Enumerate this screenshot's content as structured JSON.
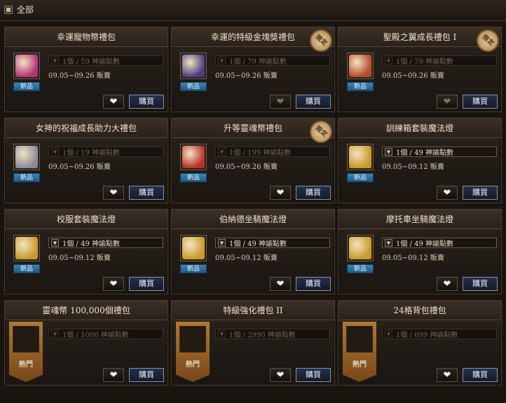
{
  "category": {
    "label": "全部"
  },
  "labels": {
    "new_badge": "新品",
    "hot_badge": "熱門",
    "limited_seal": "限定",
    "buy": "購買",
    "like_icon": "heart-icon"
  },
  "items": [
    {
      "title": "幸運寵物幣禮包",
      "qty": "1個 / 59 神諭點數",
      "date": "09.05~09.26 販賣",
      "badge": "new",
      "limited": false,
      "qty_active": false,
      "like_dim": false,
      "icon": "pet-coin-pack",
      "thumb_color": "#b1337a"
    },
    {
      "title": "幸運的特級金塊獎禮包",
      "qty": "1個 / 79 神諭點數",
      "date": "09.05~09.26 販賣",
      "badge": "new",
      "limited": true,
      "qty_active": false,
      "like_dim": true,
      "icon": "gold-chest",
      "thumb_color": "#4b3d82"
    },
    {
      "title": "聖殿之翼成長禮包 I",
      "qty": "1個 / 79 神諭點數",
      "date": "09.05~09.26 販賣",
      "badge": "new",
      "limited": true,
      "qty_active": false,
      "like_dim": true,
      "icon": "gift-bundle",
      "thumb_color": "#b84a2a"
    },
    {
      "title": "女神的祝福成長助力大禮包",
      "qty": "1個 / 19 神諭點數",
      "date": "09.05~09.26 販賣",
      "badge": "new",
      "limited": false,
      "qty_active": false,
      "like_dim": false,
      "icon": "gift-box",
      "thumb_color": "#8a8a9a"
    },
    {
      "title": "升等靈魂幣禮包",
      "qty": "1個 / 199 神諭點數",
      "date": "09.05~09.26 販賣",
      "badge": "new",
      "limited": true,
      "qty_active": false,
      "like_dim": false,
      "icon": "soul-coin-pack",
      "thumb_color": "#b8302a"
    },
    {
      "title": "訓練箱套裝魔法燈",
      "qty": "1個 / 49 神諭點數",
      "date": "09.05~09.12 販賣",
      "badge": "new",
      "limited": false,
      "qty_active": true,
      "like_dim": false,
      "icon": "magic-lamp",
      "thumb_color": "#c89a2a"
    },
    {
      "title": "校服套裝魔法燈",
      "qty": "1個 / 49 神諭點數",
      "date": "09.05~09.12 販賣",
      "badge": "new",
      "limited": false,
      "qty_active": true,
      "like_dim": false,
      "icon": "magic-lamp",
      "thumb_color": "#c89a2a"
    },
    {
      "title": "伯納德坐騎魔法燈",
      "qty": "1個 / 49 神諭點數",
      "date": "09.05~09.12 販賣",
      "badge": "new",
      "limited": false,
      "qty_active": true,
      "like_dim": false,
      "icon": "magic-lamp",
      "thumb_color": "#c89a2a"
    },
    {
      "title": "摩托車坐騎魔法燈",
      "qty": "1個 / 49 神諭點數",
      "date": "09.05~09.12 販賣",
      "badge": "new",
      "limited": false,
      "qty_active": true,
      "like_dim": false,
      "icon": "magic-lamp",
      "thumb_color": "#c89a2a"
    },
    {
      "title": "靈魂幣 100,000個禮包",
      "qty": "1個 / 1000 神諭點數",
      "date": "",
      "badge": "hot",
      "limited": false,
      "qty_active": false,
      "like_dim": false,
      "icon": "soul-coin-book",
      "thumb_color": "#a8302a"
    },
    {
      "title": "特級強化禮包 II",
      "qty": "1個 / 2990 神諭點數",
      "date": "",
      "badge": "hot",
      "limited": false,
      "qty_active": false,
      "like_dim": false,
      "icon": "enhance-cube",
      "thumb_color": "#7a4ab8"
    },
    {
      "title": "24格背包禮包",
      "qty": "1個 / 699 神諭點數",
      "date": "",
      "badge": "hot",
      "limited": false,
      "qty_active": false,
      "like_dim": false,
      "icon": "gift-box",
      "thumb_color": "#8a8a9a"
    }
  ]
}
